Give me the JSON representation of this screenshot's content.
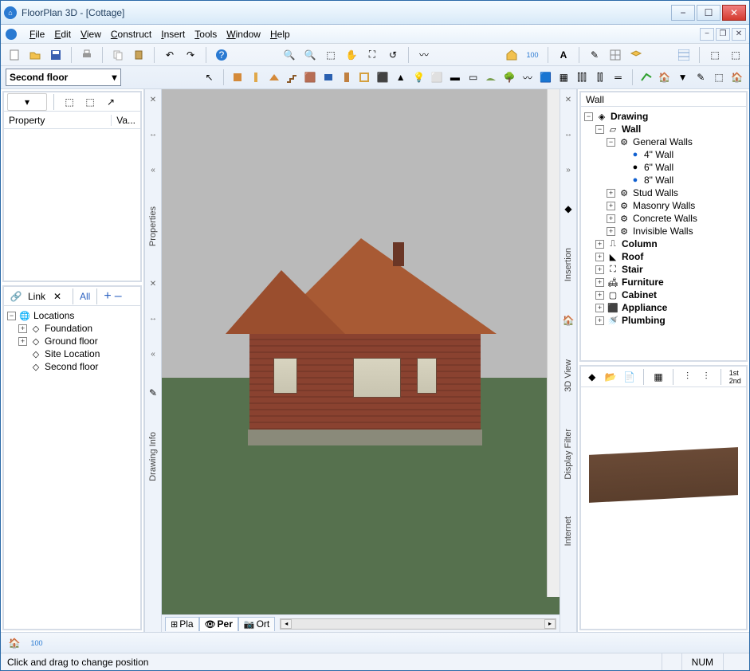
{
  "window": {
    "title": "FloorPlan 3D - [Cottage]"
  },
  "menubar": {
    "items": [
      "File",
      "Edit",
      "View",
      "Construct",
      "Insert",
      "Tools",
      "Window",
      "Help"
    ]
  },
  "floor_selector": "Second floor",
  "left_panel": {
    "property_header": "Property",
    "value_header": "Va...",
    "link_label": "Link",
    "all_label": "All",
    "plus": "+",
    "minus": "–",
    "tree_root": "Locations",
    "locations": [
      "Foundation",
      "Ground floor",
      "Site Location",
      "Second floor"
    ]
  },
  "side_tabs_left": {
    "properties": "Properties",
    "drawing_info": "Drawing Info"
  },
  "bottom_tabs": {
    "plan": "Pla",
    "pers": "Per",
    "ortho": "Ort"
  },
  "side_tabs_right": {
    "insertion": "Insertion",
    "view3d": "3D View",
    "display_filter": "Display Filter",
    "internet": "Internet"
  },
  "right_panel": {
    "title": "Wall",
    "tree": {
      "root": "Drawing",
      "wall": "Wall",
      "general_walls": "General Walls",
      "wall_4": "4\" Wall",
      "wall_6": "6\" Wall",
      "wall_8": "8\" Wall",
      "stud": "Stud Walls",
      "masonry": "Masonry Walls",
      "concrete": "Concrete Walls",
      "invisible": "Invisible Walls",
      "column": "Column",
      "roof": "Roof",
      "stair": "Stair",
      "furniture": "Furniture",
      "cabinet": "Cabinet",
      "appliance": "Appliance",
      "plumbing": "Plumbing"
    }
  },
  "statusbar": {
    "hint": "Click and drag to change position",
    "num": "NUM"
  }
}
